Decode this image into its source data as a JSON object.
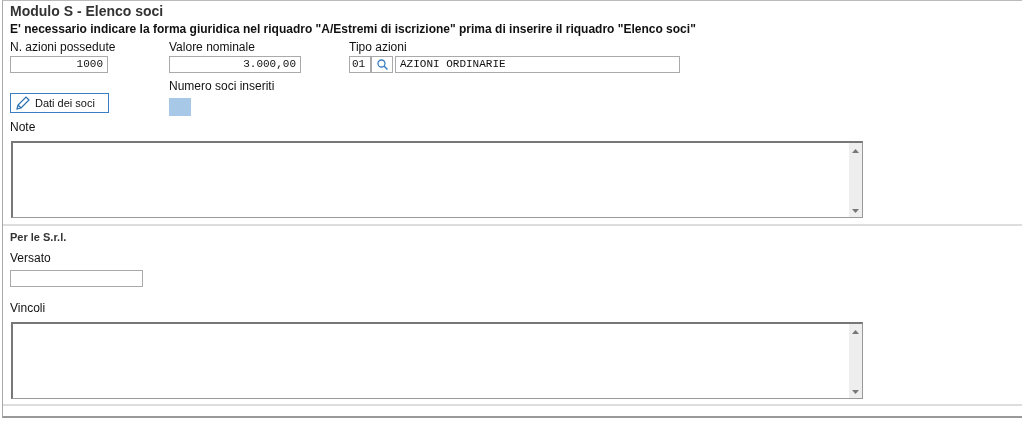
{
  "title": "Modulo S - Elenco soci",
  "notice": "E' necessario indicare la forma giuridica nel riquadro \"A/Estremi di iscrizione\" prima di inserire il riquadro \"Elenco soci\"",
  "fields": [
    {
      "label": "N. azioni possedute",
      "value": "1000"
    },
    {
      "label": "Valore nominale",
      "value": "3.000,00"
    },
    {
      "label": "Tipo azioni",
      "code": "01",
      "value": "AZIONI ORDINARIE"
    }
  ],
  "soci_button": {
    "label": "Dati dei soci"
  },
  "soci_count": {
    "label": "Numero soci inseriti"
  },
  "note": {
    "label": "Note"
  },
  "srl": {
    "heading": "Per le S.r.l.",
    "versato": {
      "label": "Versato"
    },
    "vincoli": {
      "label": "Vincoli"
    }
  }
}
